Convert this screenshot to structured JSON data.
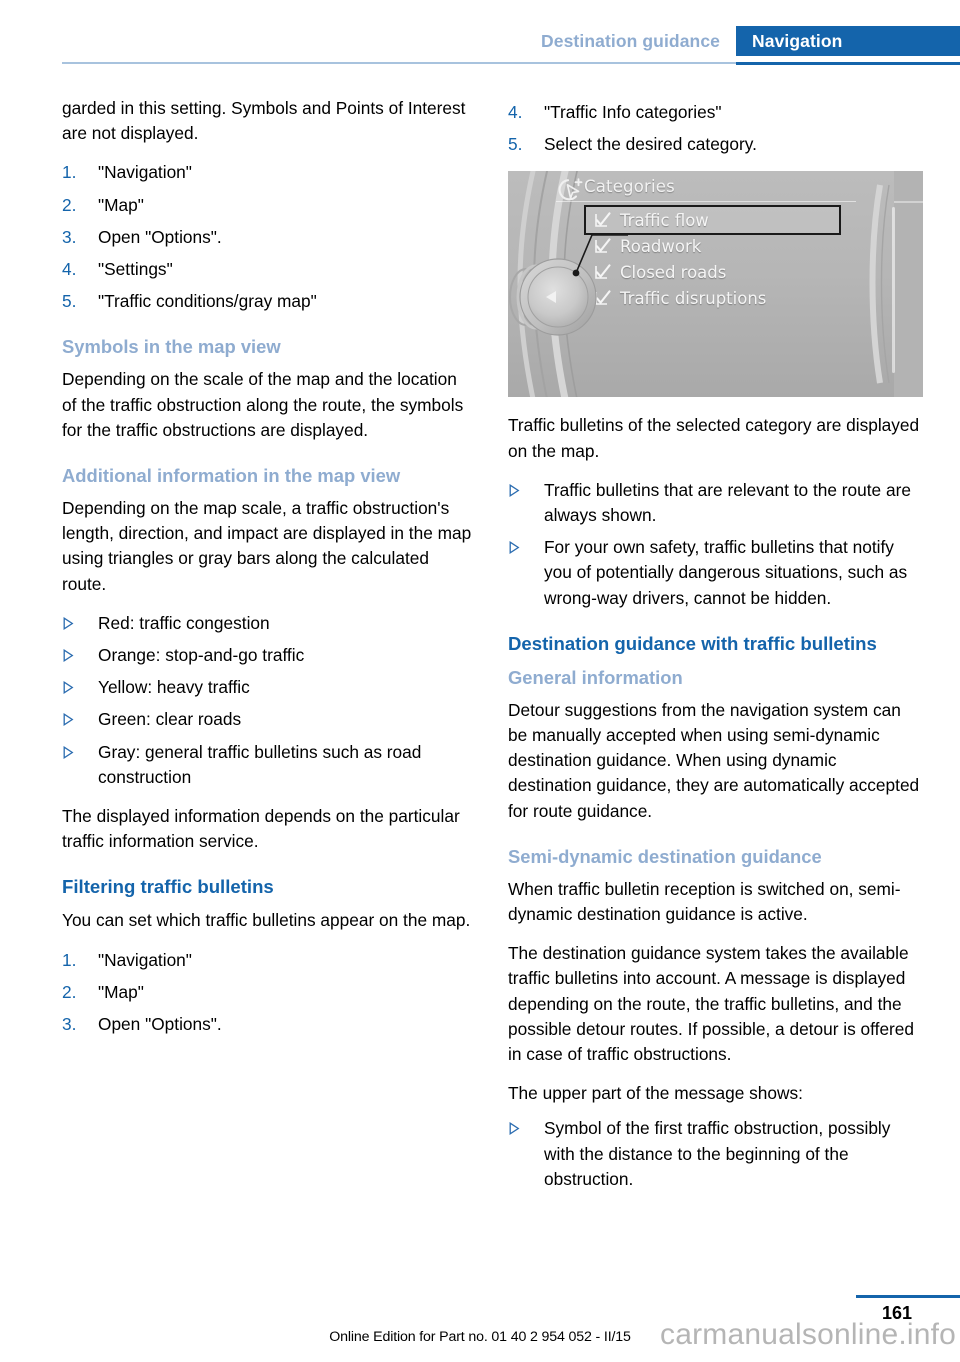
{
  "header": {
    "chapter": "Destination guidance",
    "section": "Navigation",
    "accent_color": "#1464ab",
    "muted_accent_color": "#8facd0"
  },
  "left_column": {
    "intro_paragraph": "garded in this setting. Symbols and Points of Interest are not displayed.",
    "steps_1": [
      "\"Navigation\"",
      "\"Map\"",
      "Open \"Options\".",
      "\"Settings\"",
      "\"Traffic conditions/gray map\""
    ],
    "symbols_heading": "Symbols in the map view",
    "symbols_paragraph": "Depending on the scale of the map and the location of the traffic obstruction along the route, the symbols for the traffic obstructions are displayed.",
    "additional_heading": "Additional information in the map view",
    "additional_paragraph": "Depending on the map scale, a traffic obstruction's length, direction, and impact are displayed in the map using triangles or gray bars along the calculated route.",
    "color_bullets": [
      "Red: traffic congestion",
      "Orange: stop-and-go traffic",
      "Yellow: heavy traffic",
      "Green: clear roads",
      "Gray: general traffic bulletins such as road construction"
    ],
    "service_paragraph": "The displayed information depends on the particular traffic information service.",
    "filtering_heading": "Filtering traffic bulletins",
    "filtering_paragraph": "You can set which traffic bulletins appear on the map.",
    "steps_2": [
      "\"Navigation\"",
      "\"Map\"",
      "Open \"Options\"."
    ]
  },
  "right_column": {
    "steps_continued": [
      "\"Traffic Info categories\"",
      "Select the desired category."
    ],
    "idrive_screenshot": {
      "title": "Categories",
      "title_icon": "navigation-arrow-plus-icon",
      "items": [
        {
          "label": "Traffic flow",
          "checked": true,
          "selected": true
        },
        {
          "label": "Roadwork",
          "checked": true,
          "selected": false
        },
        {
          "label": "Closed roads",
          "checked": true,
          "selected": false
        },
        {
          "label": "Traffic disruptions",
          "checked": true,
          "selected": false
        }
      ],
      "controller_icon": "idrive-controller-left-arrow"
    },
    "bulletins_paragraph": "Traffic bulletins of the selected category are displayed on the map.",
    "bulletins_bullets": [
      "Traffic bulletins that are relevant to the route are always shown.",
      "For your own safety, traffic bulletins that notify you of potentially dangerous situations, such as wrong-way drivers, cannot be hidden."
    ],
    "destination_heading": "Destination guidance with traffic bulletins",
    "general_heading": "General information",
    "general_paragraph": "Detour suggestions from the navigation system can be manually accepted when using semi-dynamic destination guidance. When using dynamic destination guidance, they are automatically accepted for route guidance.",
    "semi_heading": "Semi-dynamic destination guidance",
    "semi_paragraph_1": "When traffic bulletin reception is switched on, semi-dynamic destination guidance is active.",
    "semi_paragraph_2": "The destination guidance system takes the available traffic bulletins into account. A message is displayed depending on the route, the traffic bulletins, and the possible detour routes. If possible, a detour is offered in case of traffic obstructions.",
    "upper_part_paragraph": "The upper part of the message shows:",
    "upper_part_bullets": [
      "Symbol of the first traffic obstruction, possibly with the distance to the beginning of the obstruction."
    ]
  },
  "footer": {
    "page_number": "161",
    "online_edition": "Online Edition for Part no. 01 40 2 954 052 - II/15",
    "watermark": "carmanualsonline.info"
  }
}
